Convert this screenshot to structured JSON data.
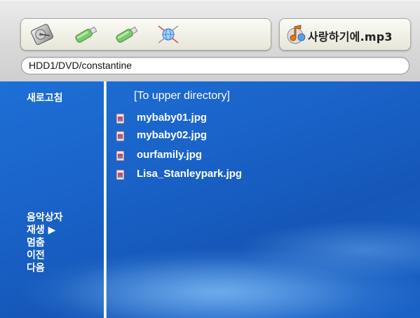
{
  "toolbar": {
    "devices": [
      {
        "icon": "hdd-icon"
      },
      {
        "icon": "usb-drive-icon"
      },
      {
        "icon": "usb-drive-icon"
      },
      {
        "icon": "network-icon"
      }
    ],
    "now_playing": {
      "icon": "music-note-icon",
      "title": "사랑하기에.mp3"
    }
  },
  "path": {
    "text": "HDD1/DVD/constantine"
  },
  "sidebar": {
    "refresh_label": "새로고침",
    "music_box_label": "음악상자",
    "play_label": "재생 ▶",
    "stop_label": "멈춤",
    "previous_label": "이전",
    "next_label": "다음"
  },
  "files": {
    "upper_directory_label": "[To upper directory]",
    "items": [
      {
        "name": "mybaby01.jpg",
        "icon": "image-file-icon"
      },
      {
        "name": "mybaby02.jpg",
        "icon": "image-file-icon"
      },
      {
        "name": "ourfamily.jpg",
        "icon": "image-file-icon"
      },
      {
        "name": "Lisa_Stanleypark.jpg",
        "icon": "image-file-icon"
      }
    ]
  },
  "colors": {
    "background_blue": "#1a63c9",
    "chrome_gray": "#d9d9d9",
    "text_white": "#ffffff"
  }
}
